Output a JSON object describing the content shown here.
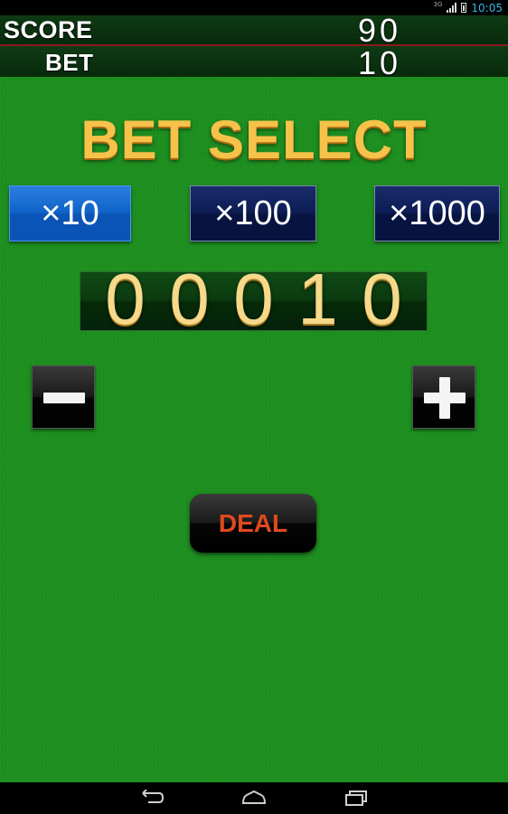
{
  "status_bar": {
    "network": "3G",
    "time": "10:05",
    "accent_color": "#33b5e5"
  },
  "hud": {
    "score_label": "SCORE",
    "score_value": "90",
    "bet_label": "BET",
    "bet_value": "10"
  },
  "title": "BET SELECT",
  "multipliers": {
    "x10": "×10",
    "x100": "×100",
    "x1000": "×1000",
    "selected": "×10"
  },
  "bet_digits": [
    "0",
    "0",
    "0",
    "1",
    "0"
  ],
  "controls": {
    "minus_icon": "minus-icon",
    "plus_icon": "plus-icon",
    "deal_label": "DEAL"
  },
  "nav": {
    "back_icon": "back-icon",
    "home_icon": "home-icon",
    "recent_icon": "recent-apps-icon"
  },
  "colors": {
    "felt": "#1d8f1f",
    "title_gold": "#f6c24a",
    "active_button": "#0f63c8",
    "inactive_button": "#0c1d55",
    "deal_text": "#e0491f"
  }
}
